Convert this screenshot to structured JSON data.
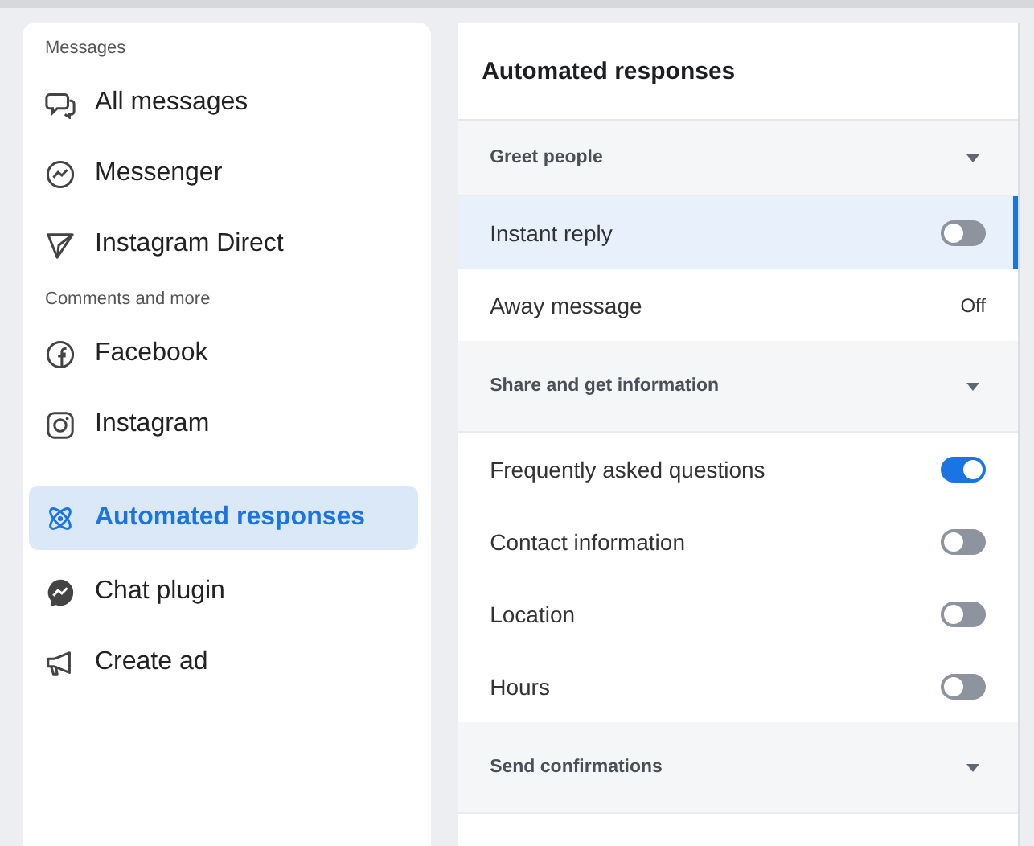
{
  "sidebar": {
    "groups": [
      {
        "heading": "Messages",
        "items": [
          {
            "label": "All messages",
            "selected": false
          },
          {
            "label": "Messenger",
            "selected": false
          },
          {
            "label": "Instagram Direct",
            "selected": false
          }
        ]
      },
      {
        "heading": "Comments and more",
        "items": [
          {
            "label": "Facebook",
            "selected": false
          },
          {
            "label": "Instagram",
            "selected": false
          }
        ]
      },
      {
        "items": [
          {
            "label": "Automated responses",
            "selected": true
          },
          {
            "label": "Chat plugin",
            "selected": false
          },
          {
            "label": "Create ad",
            "selected": false
          }
        ]
      }
    ]
  },
  "main": {
    "title": "Automated responses",
    "sections": [
      {
        "title": "Greet people",
        "rows": [
          {
            "label": "Instant reply",
            "kind": "toggle",
            "on": false,
            "selected": true
          },
          {
            "label": "Away message",
            "kind": "value",
            "value": "Off",
            "selected": false
          }
        ]
      },
      {
        "title": "Share and get information",
        "rows": [
          {
            "label": "Frequently asked questions",
            "kind": "toggle",
            "on": true,
            "selected": false
          },
          {
            "label": "Contact information",
            "kind": "toggle",
            "on": false,
            "selected": false
          },
          {
            "label": "Location",
            "kind": "toggle",
            "on": false,
            "selected": false
          },
          {
            "label": "Hours",
            "kind": "toggle",
            "on": false,
            "selected": false
          }
        ]
      },
      {
        "title": "Send confirmations"
      }
    ]
  }
}
